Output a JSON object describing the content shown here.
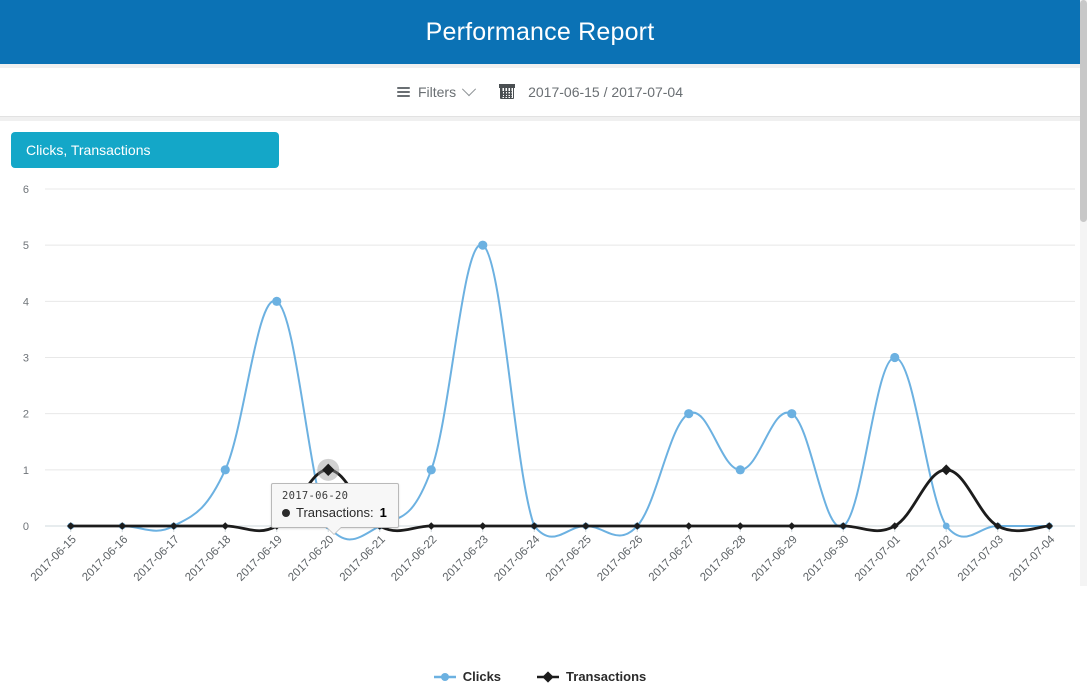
{
  "header": {
    "title": "Performance Report",
    "bg_color": "#0b72b5"
  },
  "toolbar": {
    "filters_label": "Filters",
    "filters_icon": "list-icon",
    "chevron_icon": "chevron-down-icon",
    "calendar_icon": "calendar-icon",
    "date_range": "2017-06-15 / 2017-07-04"
  },
  "card": {
    "series_tab_label": "Clicks, Transactions",
    "series_tab_color": "#14a7c8"
  },
  "tooltip": {
    "date": "2017-06-20",
    "bullet_icon": "dot-icon",
    "series": "Transactions:",
    "value": "1"
  },
  "legend": {
    "items": [
      {
        "label": "Clicks",
        "color": "#6cb1e1",
        "marker": "circle-marker"
      },
      {
        "label": "Transactions",
        "color": "#1c1c1c",
        "marker": "diamond-marker"
      }
    ]
  },
  "chart_data": {
    "type": "line",
    "title": "",
    "xlabel": "",
    "ylabel": "",
    "ylim": [
      0,
      6
    ],
    "yticks": [
      0,
      1,
      2,
      3,
      4,
      5,
      6
    ],
    "grid": true,
    "legend_position": "bottom",
    "interpolation": "smooth",
    "categories": [
      "2017-06-15",
      "2017-06-16",
      "2017-06-17",
      "2017-06-18",
      "2017-06-19",
      "2017-06-20",
      "2017-06-21",
      "2017-06-22",
      "2017-06-23",
      "2017-06-24",
      "2017-06-25",
      "2017-06-26",
      "2017-06-27",
      "2017-06-28",
      "2017-06-29",
      "2017-06-30",
      "2017-07-01",
      "2017-07-02",
      "2017-07-03",
      "2017-07-04"
    ],
    "series": [
      {
        "name": "Clicks",
        "color": "#6cb1e1",
        "values": [
          0,
          0,
          0,
          1,
          4,
          0,
          0,
          1,
          5,
          0,
          0,
          0,
          2,
          1,
          2,
          0,
          3,
          0,
          0,
          0
        ]
      },
      {
        "name": "Transactions",
        "color": "#1c1c1c",
        "values": [
          0,
          0,
          0,
          0,
          0,
          1,
          0,
          0,
          0,
          0,
          0,
          0,
          0,
          0,
          0,
          0,
          0,
          1,
          0,
          0
        ]
      }
    ],
    "highlight": {
      "series": "Transactions",
      "category": "2017-06-20",
      "value": 1
    }
  }
}
